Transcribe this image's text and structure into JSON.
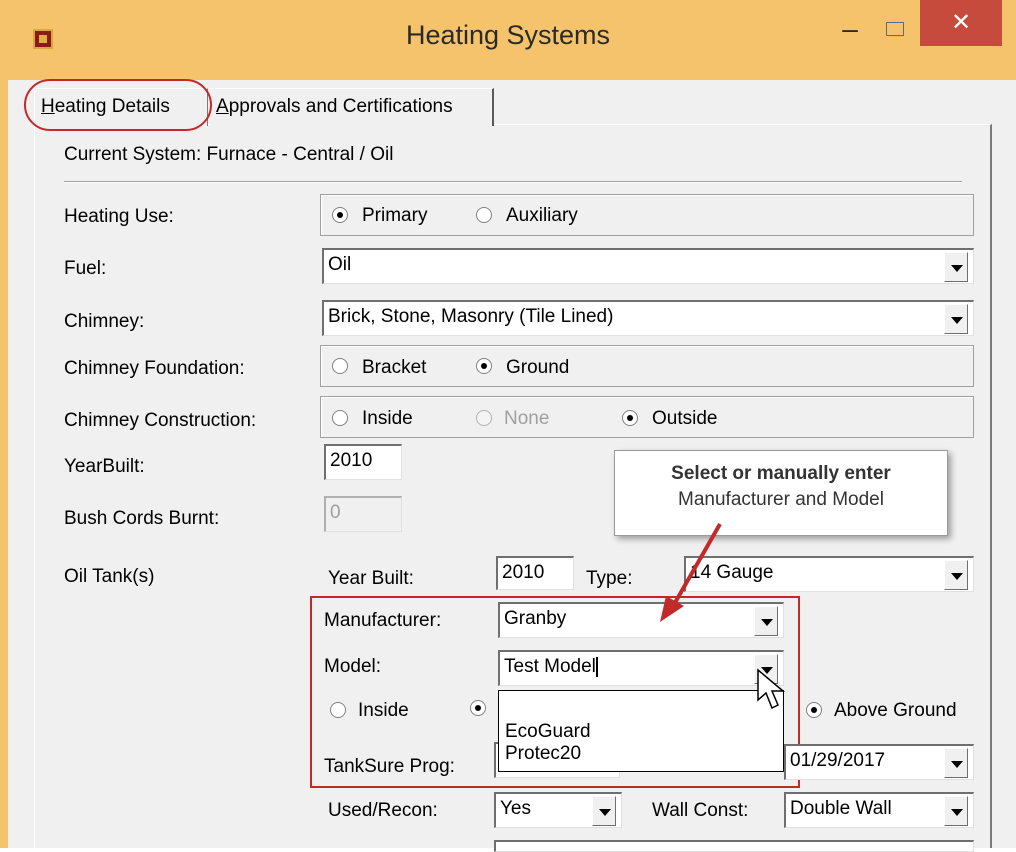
{
  "window": {
    "title": "Heating Systems",
    "minimize_glyph": "–",
    "close_glyph": "✕"
  },
  "tabs": [
    {
      "label_underlined": "H",
      "label_rest": "eating Details"
    },
    {
      "label_underlined": "A",
      "label_rest": "pprovals and Certifications"
    }
  ],
  "current_system": "Current System: Furnace - Central / Oil",
  "heating_use": {
    "label": "Heating Use:",
    "options": [
      "Primary",
      "Auxiliary"
    ],
    "selected": "Primary"
  },
  "fuel": {
    "label": "Fuel:",
    "value": "Oil"
  },
  "chimney": {
    "label": "Chimney:",
    "value": "Brick, Stone, Masonry (Tile Lined)"
  },
  "chimney_foundation": {
    "label": "Chimney Foundation:",
    "options": [
      "Bracket",
      "Ground"
    ],
    "selected": "Ground"
  },
  "chimney_construction": {
    "label": "Chimney Construction:",
    "options": [
      "Inside",
      "None",
      "Outside"
    ],
    "selected": "Outside",
    "disabled": [
      "None"
    ]
  },
  "year_built": {
    "label": "YearBuilt:",
    "value": "2010"
  },
  "bush_cords": {
    "label": "Bush Cords Burnt:",
    "value": "0"
  },
  "oil_tank": {
    "label": "Oil Tank(s)",
    "year_built_label": "Year Built:",
    "year_built_value": "2010",
    "type_label": "Type:",
    "type_value": "14 Gauge",
    "manufacturer_label": "Manufacturer:",
    "manufacturer_value": "Granby",
    "model_label": "Model:",
    "model_value": "Test Model",
    "location_inside": "Inside",
    "location_above": "Above Ground",
    "tanksure_label": "TankSure Prog:",
    "date_value": "01/29/2017",
    "used_recon_label": "Used/Recon:",
    "used_recon_value": "Yes",
    "wall_const_label": "Wall Const:",
    "wall_const_value": "Double Wall"
  },
  "model_dropdown_items": [
    "EcoGuard",
    "Protec20"
  ],
  "callout": {
    "line1": "Select or manually enter",
    "line2": "Manufacturer and Model"
  },
  "colors": {
    "frame": "#f4c36b",
    "close": "#c74b3d",
    "highlight": "#c22a2a"
  }
}
